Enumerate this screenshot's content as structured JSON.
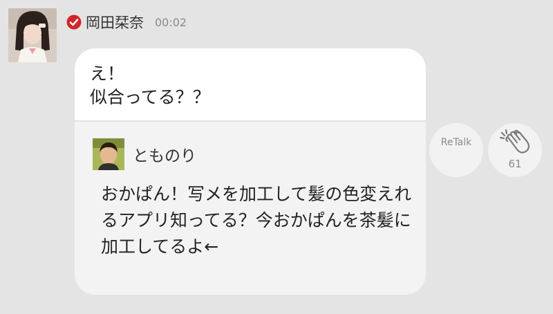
{
  "message": {
    "sender_name": "岡田栞奈",
    "timestamp": "00:02",
    "text": "え！\n似合ってる？？",
    "sender_avatar": "member-photo",
    "verified_icon": "verified-check-icon"
  },
  "quoted_reply": {
    "user_name": "とものり",
    "user_avatar": "fan-photo",
    "text": "おかぱん！写メを加工して髪の色変えれるアプリ知ってる？今おかぱんを茶髪に加工してるよ←"
  },
  "actions": {
    "retalk_label": "ReTalk",
    "clap_count": "61",
    "clap_icon": "clap-icon"
  },
  "colors": {
    "background": "#e4e4e4",
    "bubble": "#ffffff",
    "quote_background": "#f3f3f3",
    "verified_red": "#d0262b",
    "muted_text": "#8a8a8a"
  }
}
